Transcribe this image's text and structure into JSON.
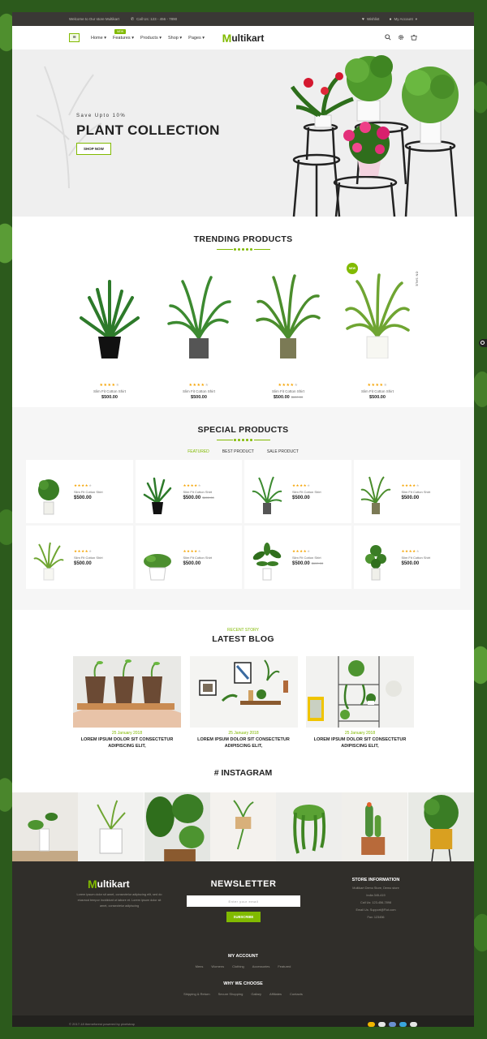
{
  "topbar": {
    "welcome": "Welcome to Our store Multikart",
    "call": "Call Us: 123 - 456 - 7890",
    "wishlist": "Wishlist",
    "account": "My Account"
  },
  "header": {
    "nav": [
      {
        "label": "Home"
      },
      {
        "label": "Features",
        "badge": "NEW"
      },
      {
        "label": "Products"
      },
      {
        "label": "Shop"
      },
      {
        "label": "Pages"
      }
    ],
    "logo_mark": "M",
    "logo_text": "ultikart"
  },
  "hero": {
    "subtitle": "Save Upto 10%",
    "title": "PLANT COLLECTION",
    "button": "SHOP NOW"
  },
  "trending": {
    "title": "TRENDING PRODUCTS",
    "products": [
      {
        "name": "Slim Fit Cotton Shirt",
        "price": "$500.00",
        "old_price": "",
        "rating": 4
      },
      {
        "name": "Slim Fit Cotton Shirt",
        "price": "$500.00",
        "old_price": "",
        "rating": 4
      },
      {
        "name": "Slim Fit Cotton Shirt",
        "price": "$500.00",
        "old_price": "$600.00",
        "rating": 4
      },
      {
        "name": "Slim Fit Cotton Shirt",
        "price": "$500.00",
        "old_price": "",
        "rating": 4,
        "badge": "NEW",
        "sale": "ON SALE"
      }
    ]
  },
  "special": {
    "title": "SPECIAL PRODUCTS",
    "tabs": [
      "FEATURED",
      "BEST PRODUCT",
      "SALE PRODUCT"
    ],
    "products": [
      {
        "name": "Slim Fit Cotton Shirt",
        "price": "$500.00",
        "old_price": ""
      },
      {
        "name": "Slim Fit Cotton Shirt",
        "price": "$500.00",
        "old_price": "$600.00"
      },
      {
        "name": "Slim Fit Cotton Shirt",
        "price": "$500.00",
        "old_price": ""
      },
      {
        "name": "Slim Fit Cotton Shirt",
        "price": "$500.00",
        "old_price": ""
      },
      {
        "name": "Slim Fit Cotton Shirt",
        "price": "$500.00",
        "old_price": ""
      },
      {
        "name": "Slim Fit Cotton Shirt",
        "price": "$500.00",
        "old_price": ""
      },
      {
        "name": "Slim Fit Cotton Shirt",
        "price": "$500.00",
        "old_price": "$600.00"
      },
      {
        "name": "Slim Fit Cotton Shirt",
        "price": "$500.00",
        "old_price": ""
      }
    ]
  },
  "blog": {
    "subtitle": "RECENT STORY",
    "title": "LATEST BLOG",
    "posts": [
      {
        "date": "25 January 2018",
        "title": "LOREM IPSUM DOLOR SIT CONSECTETUR ADIPISCING ELIT,"
      },
      {
        "date": "25 January 2018",
        "title": "LOREM IPSUM DOLOR SIT CONSECTETUR ADIPISCING ELIT,"
      },
      {
        "date": "25 January 2018",
        "title": "LOREM IPSUM DOLOR SIT CONSECTETUR ADIPISCING ELIT,"
      }
    ]
  },
  "instagram": {
    "title": "# INSTAGRAM"
  },
  "footer": {
    "logo_mark": "M",
    "logo_text": "ultikart",
    "about": "Lorem ipsum dolor sit amet, consectetur adipiscing elit, sed do eiusmod tempor incididunt ut labore et. Lorem ipsum dolor sit amet, consectetur adipiscing",
    "newsletter_title": "NEWSLETTER",
    "email_placeholder": "Enter your email",
    "subscribe": "SUBSCRIBE",
    "store_title": "STORE INFORMATION",
    "store_lines": [
      "Multikart Demo Store, Demo store",
      "India 345-419",
      "Call Us: 123-456-7898",
      "Email Us: Support@Fiot.com",
      "Fax: 123456"
    ],
    "account_title": "MY ACCOUNT",
    "account_links": [
      "Mens",
      "Womens",
      "Clothing",
      "Accessories",
      "Featured"
    ],
    "why_title": "WHY WE CHOOSE",
    "why_links": [
      "Shipping & Return",
      "Secure Shopping",
      "Gallary",
      "Affiliates",
      "Contacts"
    ],
    "copyright": "© 2017-18 themeforest powered by pixelstrap"
  },
  "colors": {
    "accent": "#81ba00",
    "footer": "#302e2a"
  }
}
